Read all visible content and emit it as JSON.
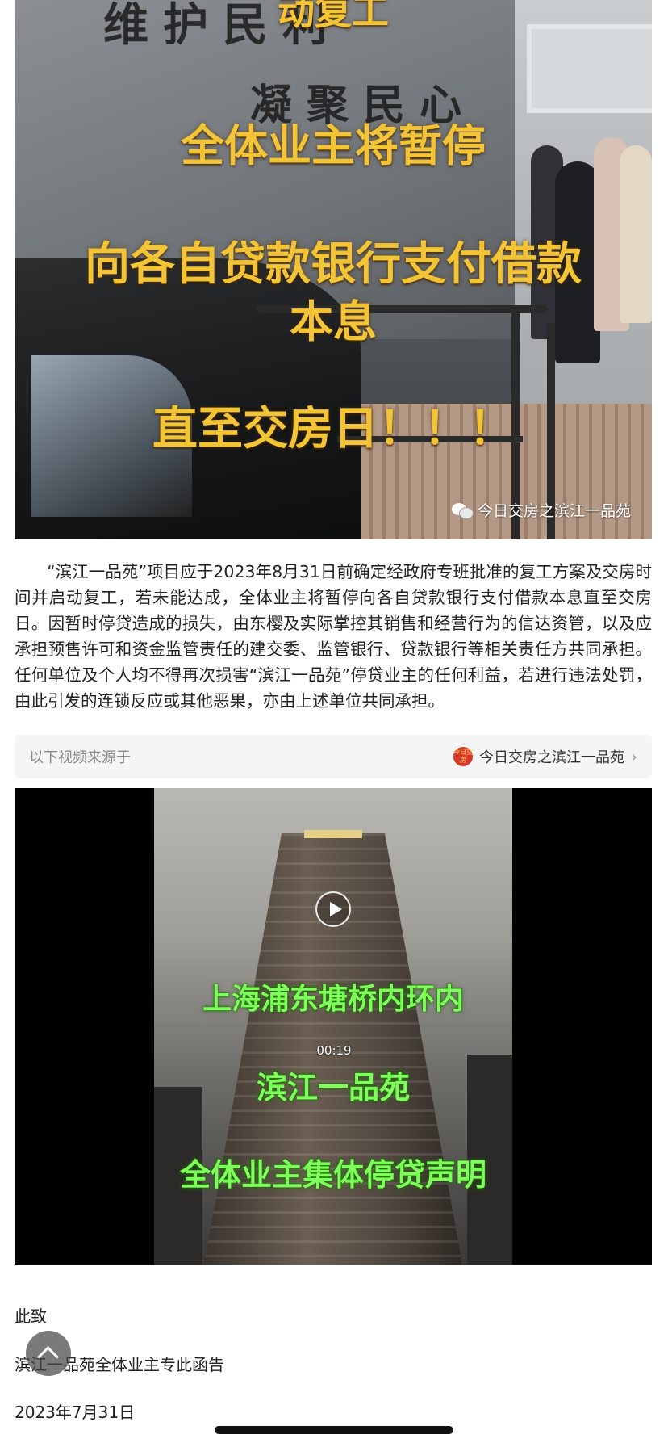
{
  "photo": {
    "wall_sign_line1": "维护民利",
    "wall_sign_line2": "凝聚民心",
    "overlay_lines": [
      "动复工",
      "全体业主将暂停",
      "向各自贷款银行支付借款",
      "本息",
      "直至交房日！！！"
    ],
    "watermark_text": "今日交房之滨江一品苑"
  },
  "article": {
    "paragraph": "“滨江一品苑”项目应于2023年8月31日前确定经政府专班批准的复工方案及交房时间并启动复工，若未能达成，全体业主将暂停向各自贷款银行支付借款本息直至交房日。因暂时停贷造成的损失，由东樱及实际掌控其销售和经营行为的信达资管，以及应承担预售许可和资金监管责任的建交委、监管银行、贷款银行等相关责任方共同承担。任何单位及个人均不得再次损害“滨江一品苑”停贷业主的任何利益，若进行违法处罚，由此引发的连锁反应或其他恶果，亦由上述单位共同承担。"
  },
  "source": {
    "label": "以下视频来源于",
    "account_name": "今日交房之滨江一品苑",
    "avatar_text": "今日交房",
    "chevron": "›"
  },
  "video": {
    "captions": [
      "上海浦东塘桥内环内",
      "滨江一品苑",
      "全体业主集体停贷声明"
    ],
    "duration": "00:19"
  },
  "footer": {
    "closing": "此致",
    "signature": "滨江一品苑全体业主专此函告",
    "date": "2023年7月31日"
  }
}
